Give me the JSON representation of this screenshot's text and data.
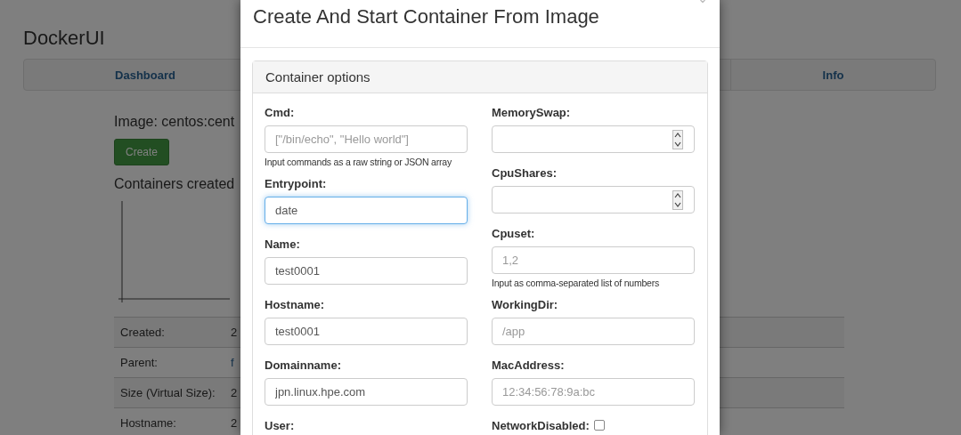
{
  "page": {
    "title": "DockerUI",
    "nav_tabs": [
      {
        "label": "Dashboard",
        "selected": false
      },
      {
        "label": "Info",
        "selected": false
      }
    ],
    "image_heading": "Image: centos:cent",
    "create_button": "Create",
    "containers_heading": "Containers created",
    "details": [
      {
        "label": "Created:",
        "value": "2",
        "kind": "text"
      },
      {
        "label": "Parent:",
        "value": "f",
        "kind": "link"
      },
      {
        "label": "Size (Virtual Size):",
        "value": "2",
        "kind": "text"
      },
      {
        "label": "Hostname:",
        "value": "2",
        "kind": "text"
      }
    ]
  },
  "dialog": {
    "title": "Create And Start Container From Image",
    "panel_title": "Container options",
    "left_fields": [
      {
        "kind": "text",
        "label": "Cmd:",
        "placeholder": "[\"/bin/echo\", \"Hello world\"]",
        "help": "Input commands as a raw string or JSON array",
        "focused": false
      },
      {
        "kind": "text",
        "label": "Entrypoint:",
        "value": "date",
        "focused": true
      },
      {
        "kind": "text",
        "label": "Name:",
        "value": "test0001",
        "focused": false
      },
      {
        "kind": "text",
        "label": "Hostname:",
        "value": "test0001",
        "focused": false
      },
      {
        "kind": "text",
        "label": "Domainname:",
        "value": "jpn.linux.hpe.com",
        "focused": false
      },
      {
        "kind": "label",
        "label": "User:"
      }
    ],
    "right_fields": [
      {
        "kind": "number",
        "label": "MemorySwap:",
        "focused": false
      },
      {
        "kind": "number",
        "label": "CpuShares:",
        "focused": false
      },
      {
        "kind": "text",
        "label": "Cpuset:",
        "placeholder": "1,2",
        "help": "Input as comma-separated list of numbers",
        "focused": false
      },
      {
        "kind": "text",
        "label": "WorkingDir:",
        "placeholder": "/app",
        "focused": false
      },
      {
        "kind": "text",
        "label": "MacAddress:",
        "placeholder": "12:34:56:78:9a:bc",
        "focused": false
      },
      {
        "kind": "checkbox",
        "label": "NetworkDisabled:",
        "checked": false
      }
    ]
  }
}
